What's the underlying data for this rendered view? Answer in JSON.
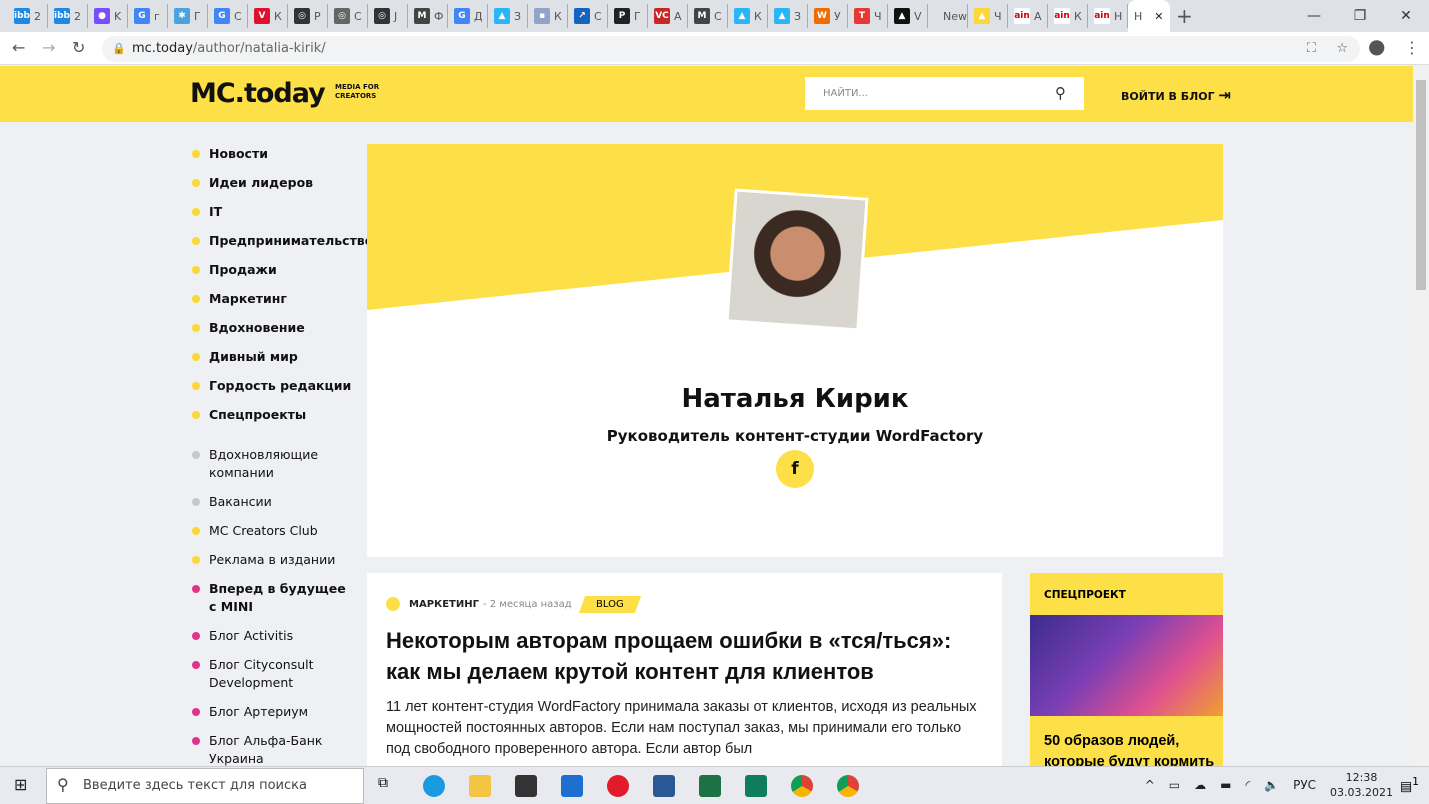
{
  "browser": {
    "tabs": [
      {
        "icon": "ibb",
        "label": "2",
        "color": "#1e88e5"
      },
      {
        "icon": "ibb",
        "label": "2",
        "color": "#1e88e5"
      },
      {
        "icon": "●",
        "label": "K",
        "color": "#7c4dff"
      },
      {
        "icon": "G",
        "label": "г",
        "color": "#4285f4"
      },
      {
        "icon": "✱",
        "label": "Г",
        "color": "#4aa3df"
      },
      {
        "icon": "G",
        "label": "С",
        "color": "#4285f4"
      },
      {
        "icon": "V",
        "label": "К",
        "color": "#e0102f"
      },
      {
        "icon": "◎",
        "label": "Р",
        "color": "#333"
      },
      {
        "icon": "◎",
        "label": "С",
        "color": "#666"
      },
      {
        "icon": "◎",
        "label": "Ј",
        "color": "#333"
      },
      {
        "icon": "M",
        "label": "Ф",
        "color": "#444"
      },
      {
        "icon": "G",
        "label": "Д",
        "color": "#4285f4"
      },
      {
        "icon": "▲",
        "label": "З",
        "color": "#29b6f6"
      },
      {
        "icon": "▪",
        "label": "К",
        "color": "#90a4c8"
      },
      {
        "icon": "↗",
        "label": "С",
        "color": "#1565c0"
      },
      {
        "icon": "P",
        "label": "Г",
        "color": "#222"
      },
      {
        "icon": "VC",
        "label": "А",
        "color": "#c62828"
      },
      {
        "icon": "M",
        "label": "С",
        "color": "#444"
      },
      {
        "icon": "▲",
        "label": "К",
        "color": "#29b6f6"
      },
      {
        "icon": "▲",
        "label": "З",
        "color": "#29b6f6"
      },
      {
        "icon": "W",
        "label": "У",
        "color": "#ef6c00"
      },
      {
        "icon": "T",
        "label": "Ч",
        "color": "#e53935"
      },
      {
        "icon": "▲",
        "label": "V",
        "color": "#111"
      },
      {
        "icon": "",
        "label": "New",
        "color": "#dee1e6"
      },
      {
        "icon": "▲",
        "label": "Ч",
        "color": "#fdd835"
      },
      {
        "icon": "ain",
        "label": "А",
        "color": "#fff"
      },
      {
        "icon": "ain",
        "label": "К",
        "color": "#fff"
      },
      {
        "icon": "ain",
        "label": "Н",
        "color": "#fff"
      }
    ],
    "active_tab": "Н",
    "url_host": "mc.today",
    "url_path": "/author/natalia-kirik/"
  },
  "site": {
    "logo": "MC.today",
    "logo_tag": "MEDIA FOR CREATORS",
    "search_placeholder": "НАЙТИ...",
    "login": "ВОЙТИ В БЛОГ"
  },
  "sidebar": [
    {
      "label": "Новости",
      "bold": true,
      "dot": "#fdd835"
    },
    {
      "label": "Идеи лидеров",
      "bold": true,
      "dot": "#fdd835"
    },
    {
      "label": "IT",
      "bold": true,
      "dot": "#fdd835"
    },
    {
      "label": "Предпринимательство",
      "bold": true,
      "dot": "#fdd835"
    },
    {
      "label": "Продажи",
      "bold": true,
      "dot": "#fdd835"
    },
    {
      "label": "Маркетинг",
      "bold": true,
      "dot": "#fdd835"
    },
    {
      "label": "Вдохновение",
      "bold": true,
      "dot": "#fdd835"
    },
    {
      "label": "Дивный мир",
      "bold": true,
      "dot": "#fdd835"
    },
    {
      "label": "Гордость редакции",
      "bold": true,
      "dot": "#fdd835"
    },
    {
      "label": "Спецпроекты",
      "bold": true,
      "dot": "#fdd835"
    },
    {
      "label": "Вдохновляющие компании",
      "bold": false,
      "dot": "#c8c8c8"
    },
    {
      "label": "Вакансии",
      "bold": false,
      "dot": "#c8c8c8"
    },
    {
      "label": "MC Creators Club",
      "bold": false,
      "dot": "#fdd835"
    },
    {
      "label": "Реклама в издании",
      "bold": false,
      "dot": "#fdd835"
    },
    {
      "label": "Вперед в будущее с MINI",
      "bold": true,
      "dot": "#e0338a"
    },
    {
      "label": "Блог Activitis",
      "bold": false,
      "dot": "#e0338a"
    },
    {
      "label": "Блог Cityconsult Development",
      "bold": false,
      "dot": "#e0338a"
    },
    {
      "label": "Блог Артериум",
      "bold": false,
      "dot": "#e0338a"
    },
    {
      "label": "Блог Альфа-Банк Украина",
      "bold": false,
      "dot": "#e0338a"
    }
  ],
  "author": {
    "name": "Наталья Кирик",
    "role": "Руководитель контент-студии WordFactory",
    "social": "f"
  },
  "article": {
    "category": "МАРКЕТИНГ",
    "time": "2 месяца назад",
    "badge": "BLOG",
    "title": "Некоторым авторам прощаем ошибки в «тся/ться»: как мы делаем крутой контент для клиентов",
    "excerpt": "11 лет контент-студия WordFactory принимала заказы от клиентов, исходя из реальных мощностей постоянных авторов. Если нам поступал заказ, мы принимали его только под свободного проверенного автора. Если автор был"
  },
  "special": {
    "label": "СПЕЦПРОЕКТ",
    "title": "50 образов людей, которые будут кормить"
  },
  "taskbar": {
    "search": "Введите здесь текст для поиска",
    "lang": "РУС",
    "time": "12:38",
    "date": "03.03.2021",
    "notifications": "1"
  }
}
